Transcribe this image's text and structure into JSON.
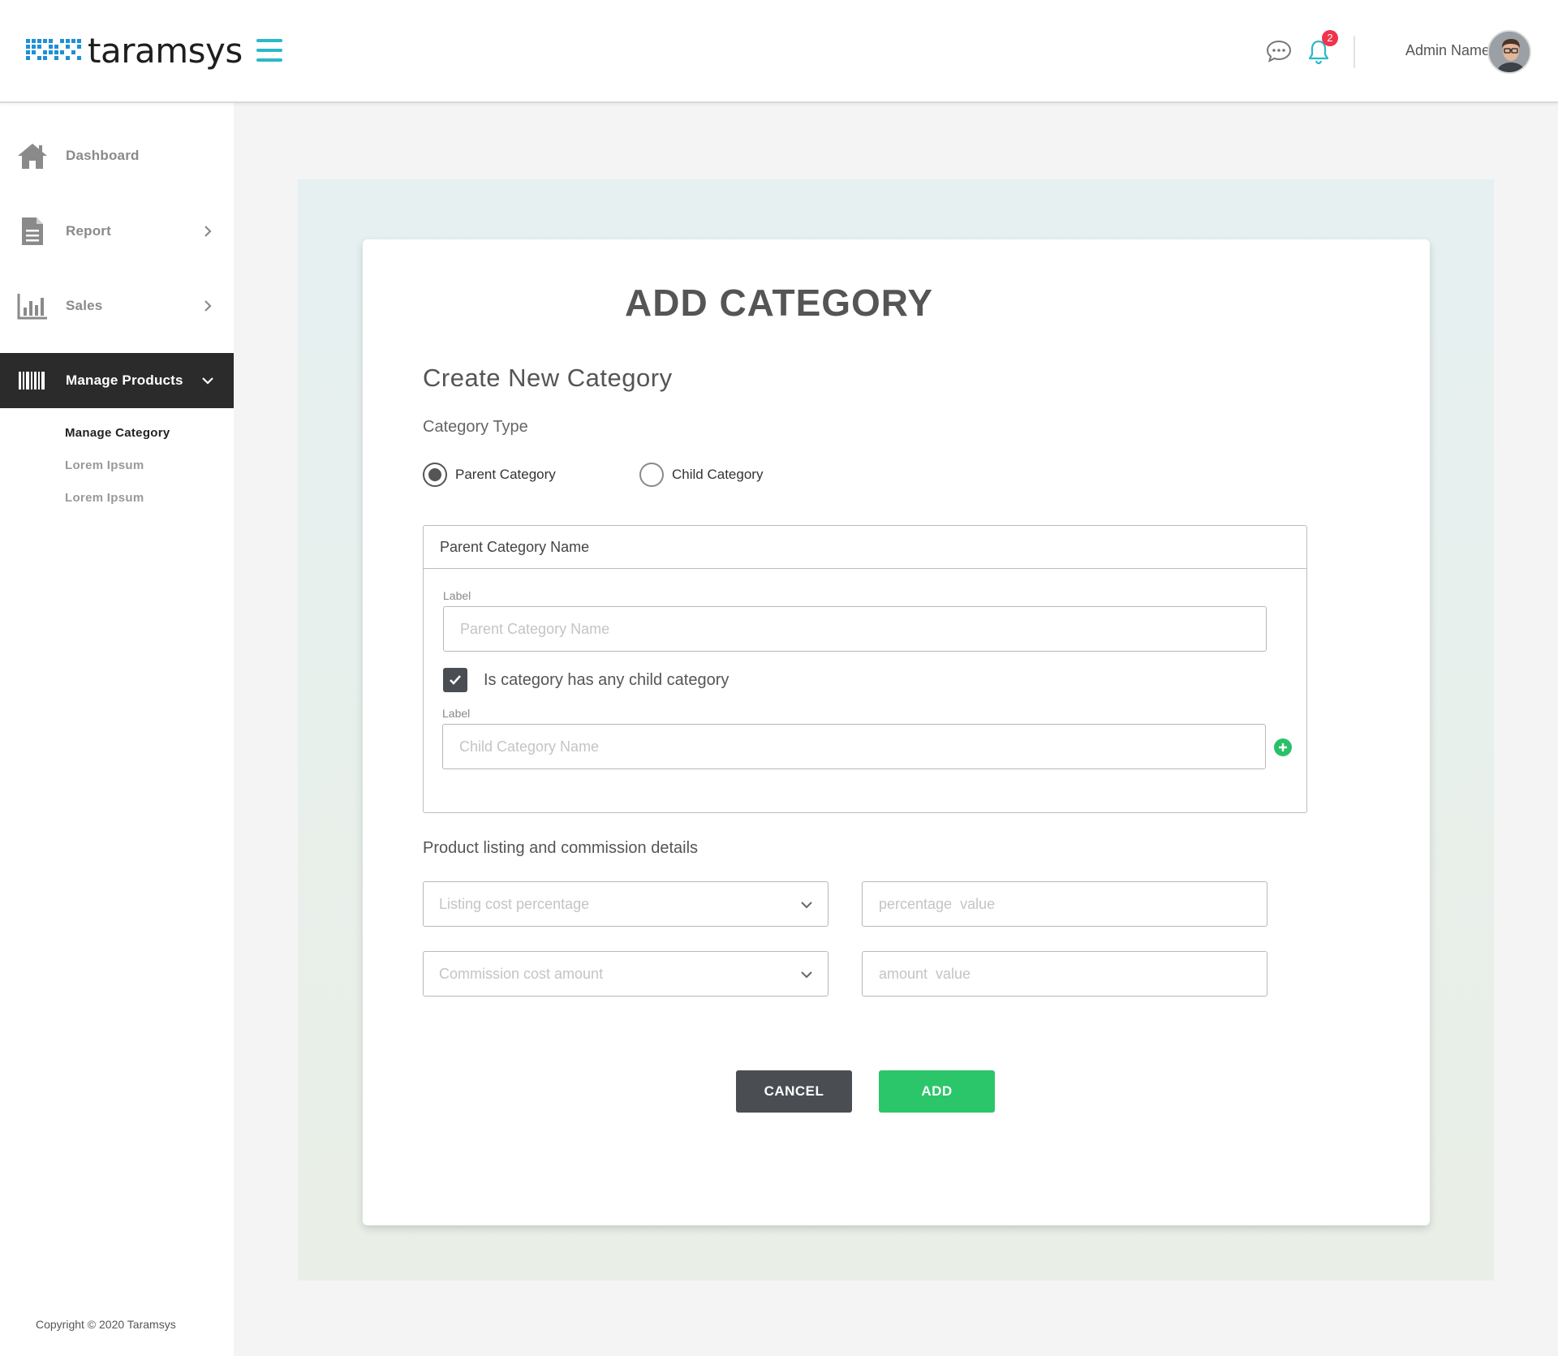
{
  "header": {
    "logo_text": "taramsys",
    "admin_name": "Admin Name",
    "notification_count": "2"
  },
  "sidebar": {
    "items": [
      {
        "label": "Dashboard",
        "icon": "home-icon"
      },
      {
        "label": "Report",
        "icon": "document-icon"
      },
      {
        "label": "Sales",
        "icon": "bar-chart-icon"
      },
      {
        "label": "Manage Products",
        "icon": "barcode-icon"
      }
    ],
    "sub_items": [
      {
        "label": "Manage Category"
      },
      {
        "label": "Lorem Ipsum"
      },
      {
        "label": "Lorem Ipsum"
      }
    ],
    "copyright": "Copyright © 2020 Taramsys"
  },
  "form": {
    "title": "ADD CATEGORY",
    "subtitle": "Create New Category",
    "category_type_label": "Category Type",
    "radio_parent": "Parent Category",
    "radio_child": "Child Category",
    "section_title": "Parent Category Name",
    "label_1": "Label",
    "parent_placeholder": "Parent Category Name",
    "checkbox_label": "Is category has any child category",
    "label_2": "Label",
    "child_placeholder": "Child Category Name",
    "listing_title": "Product listing and commission details",
    "listing_select": "Listing cost percentage",
    "percentage_placeholder": "percentage  value",
    "commission_select": "Commission cost amount",
    "amount_placeholder": "amount  value",
    "cancel_label": "CANCEL",
    "add_label": "ADD"
  },
  "colors": {
    "accent": "#29b9c8",
    "dark": "#2b2b2b",
    "success": "#2cc66a",
    "badge": "#f0334c"
  }
}
